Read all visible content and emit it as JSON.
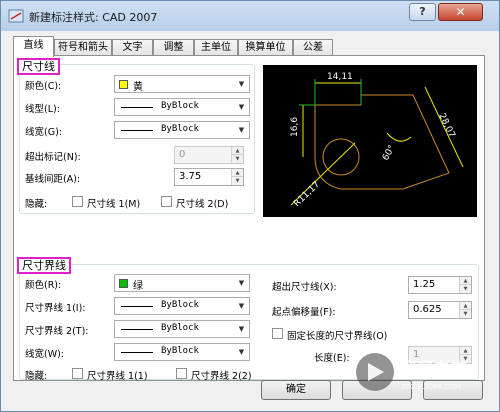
{
  "window": {
    "title": "新建标注样式: CAD 2007",
    "help": "?",
    "close": "✕"
  },
  "tabs": [
    "直线",
    "符号和箭头",
    "文字",
    "调整",
    "主单位",
    "换算单位",
    "公差"
  ],
  "dim_lines": {
    "heading": "尺寸线",
    "color_label": "颜色(C):",
    "color_value": "黄",
    "color_hex": "#ffff00",
    "linetype_label": "线型(L):",
    "linetype_value": "ByBlock",
    "lineweight_label": "线宽(G):",
    "lineweight_value": "ByBlock",
    "extend_ticks_label": "超出标记(N):",
    "extend_ticks_value": "0",
    "baseline_spacing_label": "基线间距(A):",
    "baseline_spacing_value": "3.75",
    "suppress_label": "隐藏:",
    "suppress_1": "尺寸线 1(M)",
    "suppress_2": "尺寸线 2(D)"
  },
  "ext_lines": {
    "heading": "尺寸界线",
    "color_label": "颜色(R):",
    "color_value": "绿",
    "color_hex": "#00c000",
    "linetype1_label": "尺寸界线 1(I):",
    "linetype1_value": "ByBlock",
    "linetype2_label": "尺寸界线 2(T):",
    "linetype2_value": "ByBlock",
    "lineweight_label": "线宽(W):",
    "lineweight_value": "ByBlock",
    "suppress_label": "隐藏:",
    "suppress_1": "尺寸界线 1(1)",
    "suppress_2": "尺寸界线 2(2)",
    "beyond_label": "超出尺寸线(X):",
    "beyond_value": "1.25",
    "offset_label": "起点偏移量(F):",
    "offset_value": "0.625",
    "fixed_length_label": "固定长度的尺寸界线(O)",
    "length_label": "长度(E):",
    "length_value": "1"
  },
  "preview": {
    "dim_top": "14,11",
    "dim_left": "16,6",
    "dim_right": "28,07",
    "dim_angle": "60°",
    "dim_radius": "R11,17"
  },
  "buttons": {
    "ok": "确定"
  },
  "watermark": {
    "brand": "溜溜自学",
    "url": "ZIXUE.3066.COM"
  }
}
